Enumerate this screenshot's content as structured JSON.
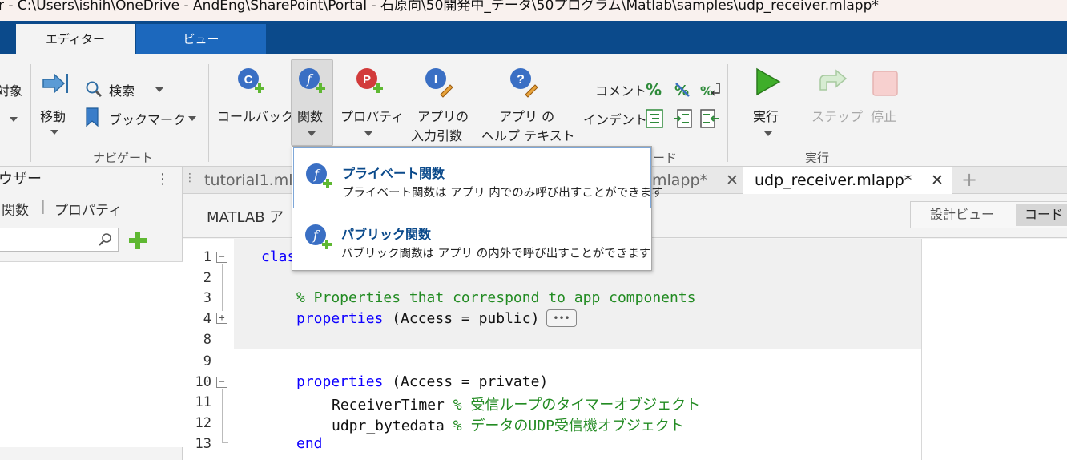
{
  "title_bar": {
    "text": "r - C:\\Users\\ishih\\OneDrive - AndEng\\SharePoint\\Portal - 石原向\\50開発中_データ\\50プログラム\\Matlab\\samples\\udp_receiver.mlapp*"
  },
  "ribbon_tabs": {
    "editor": "エディター",
    "view": "ビュー"
  },
  "toolstrip": {
    "target": "対象",
    "find": "検索",
    "goto": "移動",
    "bookmark": "ブックマーク",
    "navigate_group": "ナビゲート",
    "callback": "コールバック",
    "function": "関数",
    "property": "プロパティ",
    "app_input_line1": "アプリの",
    "app_input_line2": "入力引数",
    "app_help_line1": "アプリ の",
    "app_help_line2": "ヘルプ テキスト",
    "comment": "コメント",
    "indent": "インデント",
    "code_group_partial": "ード",
    "run": "実行",
    "step": "ステップ",
    "stop": "停止",
    "run_group": "実行"
  },
  "browser": {
    "title": "ウザー",
    "tab_functions": "関数",
    "tab_separator": "|",
    "tab_properties": "プロパティ"
  },
  "doc_tabs": [
    {
      "label": "tutorial1.ml"
    },
    {
      "label": "mlapp*"
    },
    {
      "label": "udp_receiver.mlapp*"
    }
  ],
  "subbar": {
    "title": "MATLAB ア",
    "design_view": "設計ビュー",
    "code_view": "コード"
  },
  "dropdown": {
    "items": [
      {
        "title": "プライベート関数",
        "desc": "プライベート関数は アプリ 内でのみ呼び出すことができます"
      },
      {
        "title": "パブリック関数",
        "desc": "パブリック関数は アプリ の内外で呼び出すことができます"
      }
    ]
  },
  "editor": {
    "line_numbers": [
      "1",
      "2",
      "3",
      "4",
      "8",
      "9",
      "10",
      "11",
      "12",
      "13"
    ],
    "code": {
      "l1": "clas",
      "l3": "% Properties that correspond to app components",
      "l4_kw": "properties",
      "l4_rest": " (Access = public)",
      "collapsed": "•••",
      "l10_kw": "properties",
      "l10_rest": " (Access = private)",
      "l11_name": "ReceiverTimer ",
      "l11_comment": "% 受信ループのタイマーオブジェクト",
      "l12_name": "udpr_bytedata ",
      "l12_comment": "% データのUDP受信機オブジェクト",
      "l13": "end"
    }
  },
  "icons": {
    "callback": "callback-add-icon",
    "function": "function-add-icon",
    "property": "property-add-icon",
    "app_input": "app-input-edit-icon",
    "app_help": "help-edit-icon",
    "run": "play-icon",
    "step": "step-icon",
    "stop": "stop-icon"
  },
  "colors": {
    "ribbon_blue": "#0b4a8b",
    "keyword": "#0e00ff",
    "comment": "#228b22",
    "run_green": "#3fae2a"
  }
}
